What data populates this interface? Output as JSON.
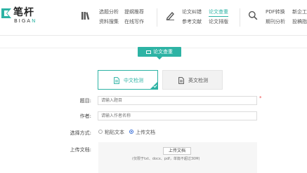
{
  "header": {
    "brand_cn": "笔杆",
    "brand_en_prefix": "BIGA",
    "brand_en_accent": "N",
    "nav": {
      "group1": [
        "选题分析",
        "资料搜集",
        "提纲推荐",
        "在线写作"
      ],
      "group2": [
        "论文纠错",
        "参考文献",
        "论文查重",
        "论文排版"
      ],
      "group3": [
        "PDF转换",
        "期刊分析",
        "新企工",
        "投稿指"
      ]
    },
    "icons": [
      "books-icon",
      "pen-icon",
      "search-icon"
    ]
  },
  "main": {
    "badge": "论文查重",
    "tabs": [
      {
        "label": "中文检测",
        "active": true
      },
      {
        "label": "英文检测",
        "active": false
      }
    ],
    "form": {
      "title_label": "题目:",
      "title_placeholder": "请输入题目",
      "required_mark": "*",
      "author_label": "作者:",
      "author_placeholder": "请输入作者名称",
      "method_label": "选择方式:",
      "method_options": [
        {
          "label": "粘贴文本",
          "selected": false
        },
        {
          "label": "上传文档",
          "selected": true
        }
      ],
      "upload_label": "上传文档:",
      "upload_button": "上传文档",
      "upload_hint": "(仅限于txt、docx、pdf，单篇不超过30M)"
    }
  },
  "colors": {
    "accent": "#2db3a4",
    "radio_selected": "#3a6fd8",
    "required": "#e44444"
  }
}
